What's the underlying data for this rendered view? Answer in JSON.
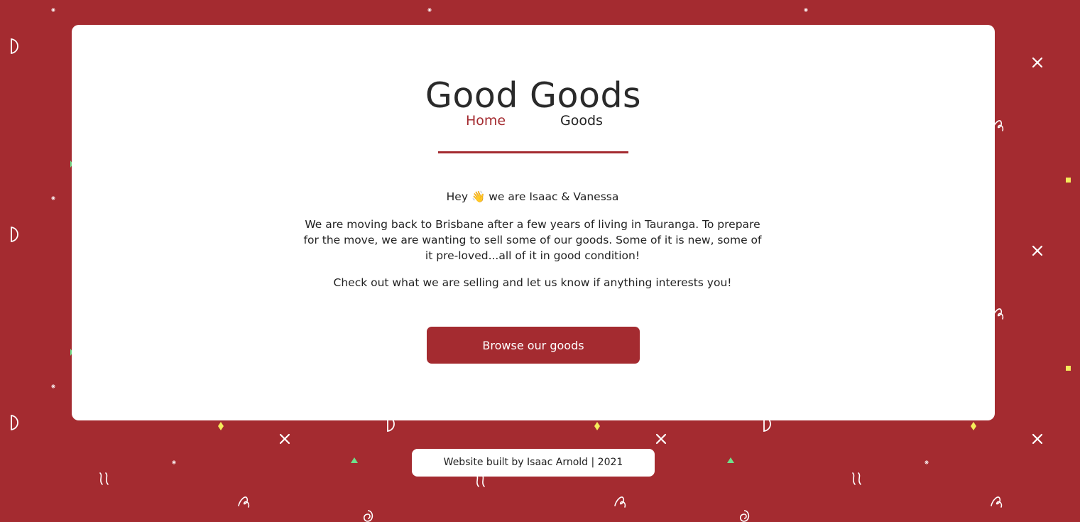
{
  "site": {
    "title": "Good Goods"
  },
  "nav": {
    "items": [
      {
        "label": "Home",
        "active": true
      },
      {
        "label": "Goods",
        "active": false
      }
    ]
  },
  "intro": {
    "greeting_before": "Hey ",
    "greeting_emoji": "👋",
    "greeting_after": " we are Isaac & Vanessa",
    "paragraph1": "We are moving back to Brisbane after a few years of living in Tauranga. To prepare for the move, we are wanting to sell some of our goods. Some of it is new, some of it pre-loved...all of it in good condition!",
    "paragraph2": "Check out what we are selling and let us know if anything interests you!"
  },
  "cta": {
    "label": "Browse our goods"
  },
  "footer": {
    "text": "Website built by Isaac Arnold | 2021"
  },
  "colors": {
    "brand": "#a42b30",
    "card": "#ffffff",
    "text": "#222222",
    "confetti_yellow": "#f4ec5b",
    "confetti_green": "#6fe08a"
  }
}
